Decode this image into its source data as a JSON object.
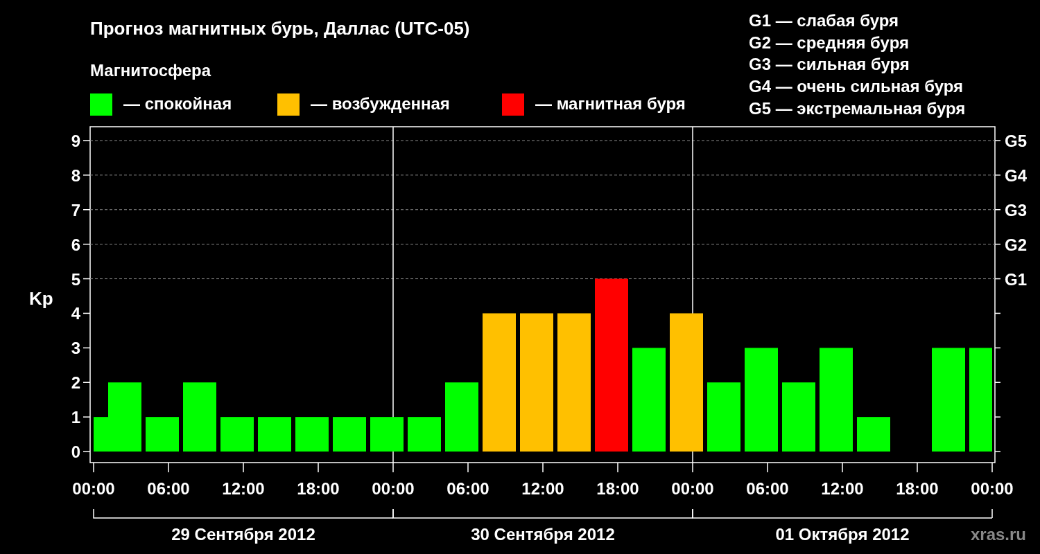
{
  "chart_data": {
    "type": "bar",
    "title": "Прогноз магнитных бурь, Даллас (UTC-05)",
    "ylabel": "Kp",
    "x": [
      "2012-09-29T00:00",
      "2012-09-29T02:30",
      "2012-09-29T05:30",
      "2012-09-29T08:30",
      "2012-09-29T11:30",
      "2012-09-29T14:30",
      "2012-09-29T17:30",
      "2012-09-29T20:30",
      "2012-09-29T23:30",
      "2012-09-30T02:30",
      "2012-09-30T05:30",
      "2012-09-30T08:30",
      "2012-09-30T11:30",
      "2012-09-30T14:30",
      "2012-09-30T17:30",
      "2012-09-30T20:30",
      "2012-09-30T23:30",
      "2012-10-01T02:30",
      "2012-10-01T05:30",
      "2012-10-01T08:30",
      "2012-10-01T11:30",
      "2012-10-01T14:30",
      null,
      "2012-10-01T20:30",
      "2012-10-01T23:30"
    ],
    "series": [
      {
        "name": "спокойная",
        "color": "#00ff00",
        "values": [
          1,
          2,
          1,
          2,
          1,
          1,
          1,
          1,
          1,
          1,
          2,
          null,
          null,
          null,
          null,
          3,
          null,
          2,
          3,
          2,
          3,
          1,
          null,
          3,
          3
        ]
      },
      {
        "name": "возбужденная",
        "color": "#ffc000",
        "values": [
          null,
          null,
          null,
          null,
          null,
          null,
          null,
          null,
          null,
          null,
          null,
          4,
          4,
          4,
          null,
          null,
          4,
          null,
          null,
          null,
          null,
          null,
          null,
          null,
          null
        ]
      },
      {
        "name": "магнитная буря",
        "color": "#ff0000",
        "values": [
          null,
          null,
          null,
          null,
          null,
          null,
          null,
          null,
          null,
          null,
          null,
          null,
          null,
          null,
          5,
          null,
          null,
          null,
          null,
          null,
          null,
          null,
          null,
          null,
          null
        ]
      }
    ],
    "xlim": [
      "2012-09-29T00:00",
      "2012-10-02T00:00"
    ],
    "ylim": [
      -0.32,
      9.4
    ],
    "xticks": [
      {
        "value": "2012-09-29T00:00",
        "label": "00:00"
      },
      {
        "value": "2012-09-29T06:00",
        "label": "06:00"
      },
      {
        "value": "2012-09-29T12:00",
        "label": "12:00"
      },
      {
        "value": "2012-09-29T18:00",
        "label": "18:00"
      },
      {
        "value": "2012-09-30T00:00",
        "label": "00:00"
      },
      {
        "value": "2012-09-30T06:00",
        "label": "06:00"
      },
      {
        "value": "2012-09-30T12:00",
        "label": "12:00"
      },
      {
        "value": "2012-09-30T18:00",
        "label": "18:00"
      },
      {
        "value": "2012-10-01T00:00",
        "label": "00:00"
      },
      {
        "value": "2012-10-01T06:00",
        "label": "06:00"
      },
      {
        "value": "2012-10-01T12:00",
        "label": "12:00"
      },
      {
        "value": "2012-10-01T18:00",
        "label": "18:00"
      },
      {
        "value": "2012-10-02T00:00",
        "label": "00:00"
      }
    ],
    "yticks": [
      0,
      1,
      2,
      3,
      4,
      5,
      6,
      7,
      8,
      9
    ],
    "grid": true,
    "legend": {
      "title": "Магнитосфера",
      "separator": "—"
    }
  },
  "storm_scale": [
    "G5",
    "G4",
    "G3",
    "G2",
    "G1"
  ],
  "scale_legend": [
    "G1 — слабая буря",
    "G2 — средняя буря",
    "G3 — сильная буря",
    "G4 — очень сильная буря",
    "G5 — экстремальная буря"
  ],
  "dates": [
    "29 Сентября 2012",
    "30 Сентября 2012",
    "01 Октября 2012"
  ],
  "credit": "xras.ru"
}
